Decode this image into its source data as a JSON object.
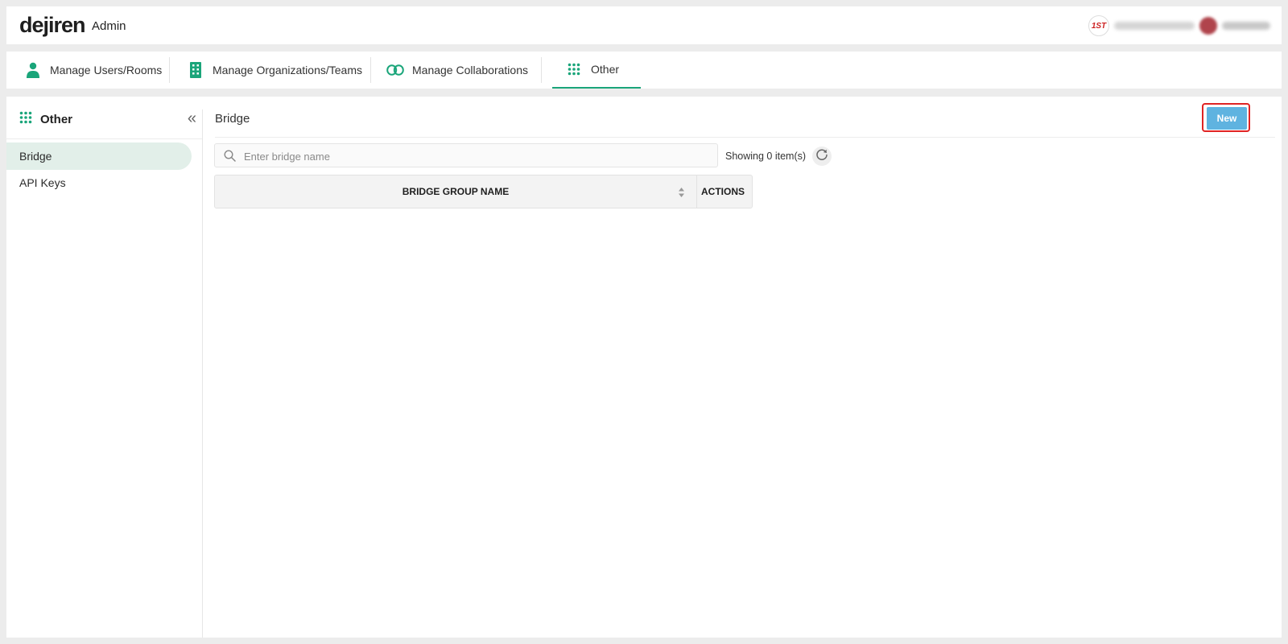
{
  "header": {
    "logo": "dejiren",
    "app_name": "Admin",
    "badge": "1ST"
  },
  "tabs": [
    {
      "label": "Manage Users/Rooms",
      "icon": "user-icon"
    },
    {
      "label": "Manage Organizations/Teams",
      "icon": "building-icon"
    },
    {
      "label": "Manage Collaborations",
      "icon": "link-icon"
    },
    {
      "label": "Other",
      "icon": "grid-dots-icon",
      "active": true
    }
  ],
  "sidebar": {
    "title": "Other",
    "collapse_icon": "double-chevron-left-icon",
    "items": [
      {
        "label": "Bridge",
        "active": true
      },
      {
        "label": "API Keys"
      }
    ]
  },
  "main": {
    "title": "Bridge",
    "new_button": "New",
    "search": {
      "placeholder": "Enter bridge name",
      "value": ""
    },
    "count_text": "Showing 0 item(s)",
    "table": {
      "columns": [
        "BRIDGE GROUP NAME",
        "ACTIONS"
      ],
      "rows": []
    }
  },
  "colors": {
    "accent": "#1aa57a",
    "new_button": "#5fb3e0",
    "highlight_frame": "#e02424",
    "active_sidebar_bg": "#e2efe9"
  }
}
